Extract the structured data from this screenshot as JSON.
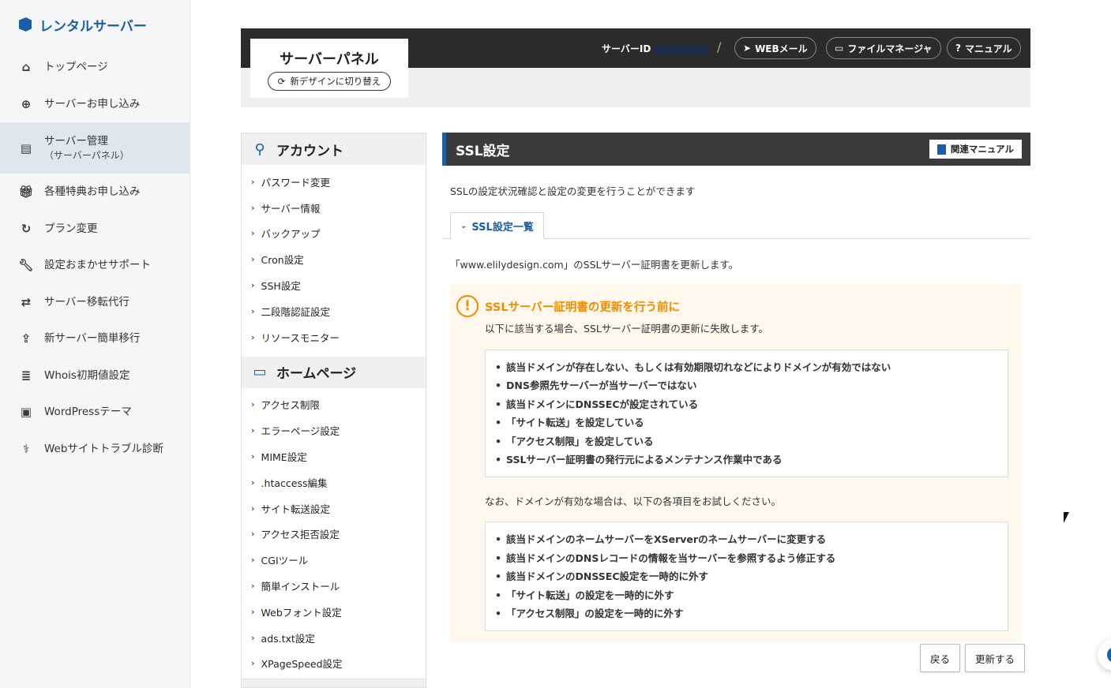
{
  "brand": {
    "name": "レンタルサーバー"
  },
  "sidebar": {
    "items": [
      {
        "label": "トップページ",
        "sub": "",
        "icon": "home-icon"
      },
      {
        "label": "サーバーお申し込み",
        "sub": "",
        "icon": "plus-circle-icon"
      },
      {
        "label": "サーバー管理",
        "sub": "（サーバーパネル）",
        "icon": "server-icon"
      },
      {
        "label": "各種特典お申し込み",
        "sub": "",
        "icon": "gift-icon"
      },
      {
        "label": "プラン変更",
        "sub": "",
        "icon": "refresh-icon"
      },
      {
        "label": "設定おまかせサポート",
        "sub": "",
        "icon": "wrench-icon"
      },
      {
        "label": "サーバー移転代行",
        "sub": "",
        "icon": "server-move-icon"
      },
      {
        "label": "新サーバー簡単移行",
        "sub": "",
        "icon": "upload-icon"
      },
      {
        "label": "Whois初期値設定",
        "sub": "",
        "icon": "document-icon"
      },
      {
        "label": "WordPressテーマ",
        "sub": "",
        "icon": "window-icon"
      },
      {
        "label": "Webサイトトラブル診断",
        "sub": "",
        "icon": "stethoscope-icon"
      }
    ]
  },
  "header": {
    "panel_title": "サーバーパネル",
    "switch_label": "新デザインに切り替え",
    "server_id_label": "サーバーID",
    "separator": "/",
    "webmail": "WEBメール",
    "file_manager": "ファイルマネージャ",
    "manual": "マニュアル"
  },
  "account_menu": {
    "heading": "アカウント",
    "items": [
      "パスワード変更",
      "サーバー情報",
      "バックアップ",
      "Cron設定",
      "SSH設定",
      "二段階認証設定",
      "リソースモニター"
    ]
  },
  "homepage_menu": {
    "heading": "ホームページ",
    "items": [
      "アクセス制限",
      "エラーページ設定",
      "MIME設定",
      ".htaccess編集",
      "サイト転送設定",
      "アクセス拒否設定",
      "CGIツール",
      "簡単インストール",
      "Webフォント設定",
      "ads.txt設定",
      "XPageSpeed設定"
    ]
  },
  "main": {
    "title": "SSL設定",
    "manual_button": "関連マニュアル",
    "intro": "SSLの設定状況確認と設定の変更を行うことができます",
    "tab_label": "SSL設定一覧",
    "renew_text": "「www.elilydesign.com」のSSLサーバー証明書を更新します。",
    "warning": {
      "title": "SSLサーバー証明書の更新を行う前に",
      "subtitle": "以下に該当する場合、SSLサーバー証明書の更新に失敗します。",
      "conditions": [
        "該当ドメインが存在しない、もしくは有効期限切れなどによりドメインが有効ではない",
        "DNS参照先サーバーが当サーバーではない",
        "該当ドメインにDNSSECが設定されている",
        "「サイト転送」を設定している",
        "「アクセス制限」を設定している",
        "SSLサーバー証明書の発行元によるメンテナンス作業中である"
      ],
      "note": "なお、ドメインが有効な場合は、以下の各項目をお試しください。",
      "remedies": [
        "該当ドメインのネームサーバーをXServerのネームサーバーに変更する",
        "該当ドメインのDNSレコードの情報を当サーバーを参照するよう修正する",
        "該当ドメインのDNSSEC設定を一時的に外す",
        "「サイト転送」の設定を一時的に外す",
        "「アクセス制限」の設定を一時的に外す"
      ]
    },
    "back_button": "戻る",
    "update_button": "更新する"
  }
}
